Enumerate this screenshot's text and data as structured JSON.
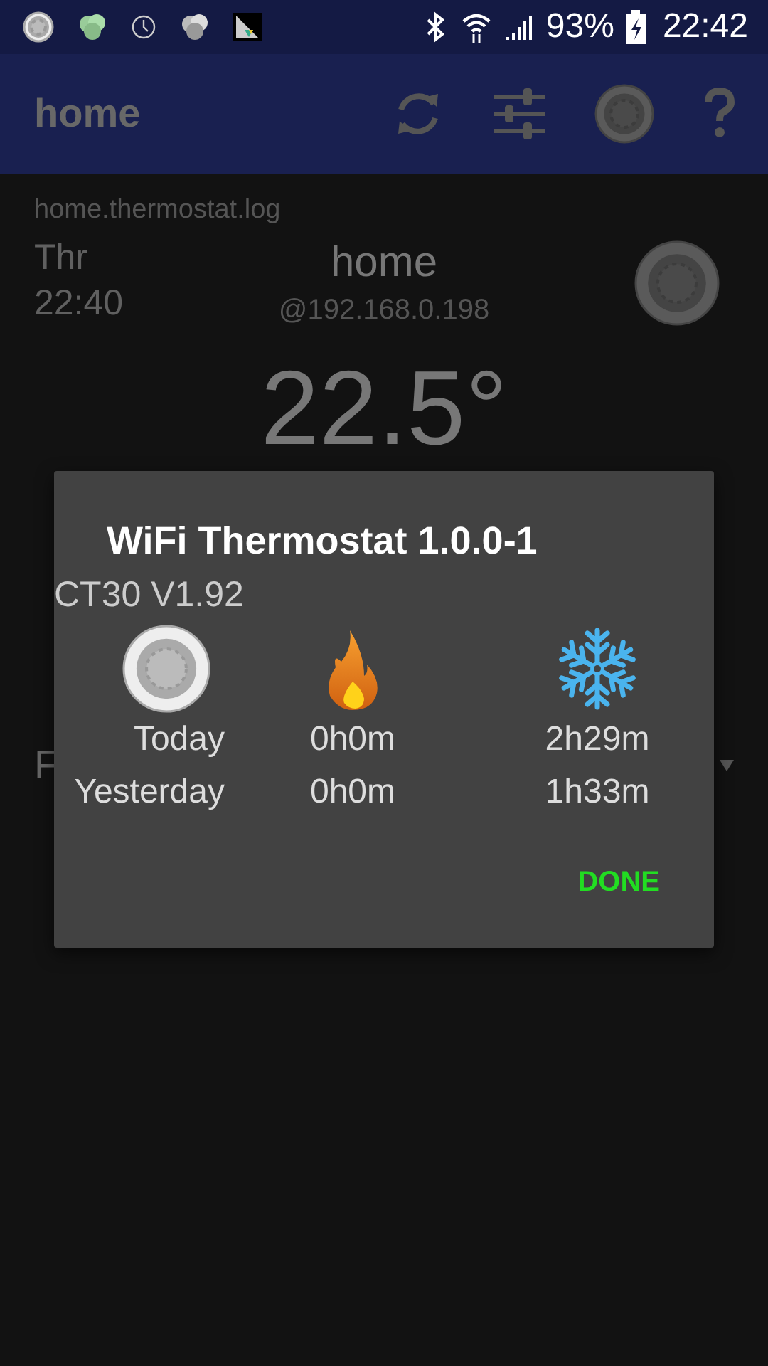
{
  "status_bar": {
    "battery": "93%",
    "time": "22:42"
  },
  "app_bar": {
    "title": "home"
  },
  "background": {
    "log_name": "home.thermostat.log",
    "day": "Thr",
    "time": "22:40",
    "device_name": "home",
    "address": "@192.168.0.198",
    "temperature": "22.5°",
    "partial_label": "F"
  },
  "dialog": {
    "title": "WiFi Thermostat 1.0.0-1",
    "model": "CT30 V1.92",
    "rows": [
      {
        "label": "Today",
        "heat": "0h0m",
        "cool": "2h29m"
      },
      {
        "label": "Yesterday",
        "heat": "0h0m",
        "cool": "1h33m"
      }
    ],
    "button": "DONE"
  }
}
